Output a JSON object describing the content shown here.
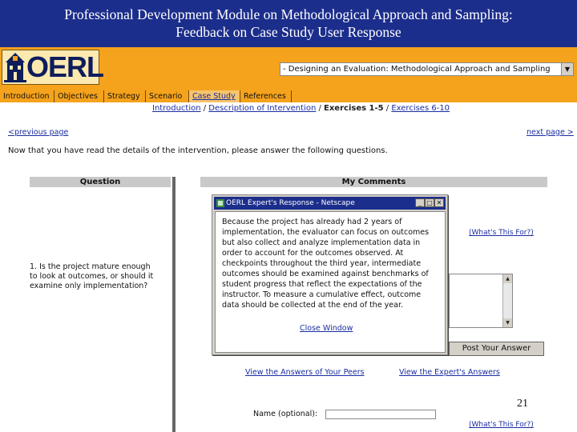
{
  "slide": {
    "title_line1": "Professional Development Module on Methodological Approach and Sampling:",
    "title_line2": "Feedback on Case Study User Response",
    "page_number": "21"
  },
  "app": {
    "logo_text": "OERL",
    "module_select": {
      "selected": "- Designing an Evaluation: Methodological Approach and Sampling"
    }
  },
  "tabs": [
    {
      "label": "Introduction"
    },
    {
      "label": "Objectives"
    },
    {
      "label": "Strategy"
    },
    {
      "label": "Scenario"
    },
    {
      "label": "Case Study",
      "active": true
    },
    {
      "label": "References"
    }
  ],
  "breadcrumb": {
    "intro": "Introduction",
    "sep": " / ",
    "description": "Description of Intervention",
    "current": "Exercises 1-5",
    "next": "Exercises 6-10"
  },
  "nav": {
    "prev": "<previous page",
    "next": "next page >"
  },
  "instruction": "Now that you have read the details of the intervention, please answer the following questions.",
  "table": {
    "col_question": "Question",
    "col_comments": "My Comments",
    "question_1": "1. Is the project mature enough to look at outcomes, or should it examine only implementation?",
    "whats_this": "(What's This For?)",
    "post_button": "Post Your Answer",
    "view_peers": "View the Answers of Your Peers",
    "view_expert": "View the Expert's Answers",
    "name_label": "Name (optional):"
  },
  "popup": {
    "title": "OERL Expert's Response - Netscape",
    "body": "Because the project has already had 2 years of implementation, the evaluator can focus on outcomes but also collect and analyze implementation data in order to account for the outcomes observed. At checkpoints throughout the third year, intermediate outcomes should be examined against benchmarks of student progress that reflect the expectations of the instructor. To measure a cumulative effect, outcome data should be collected at the end of the year.",
    "close": "Close Window"
  },
  "colors": {
    "header_blue": "#1c2e8c",
    "accent_orange": "#f5a21c",
    "link_blue": "#1a2da0"
  }
}
